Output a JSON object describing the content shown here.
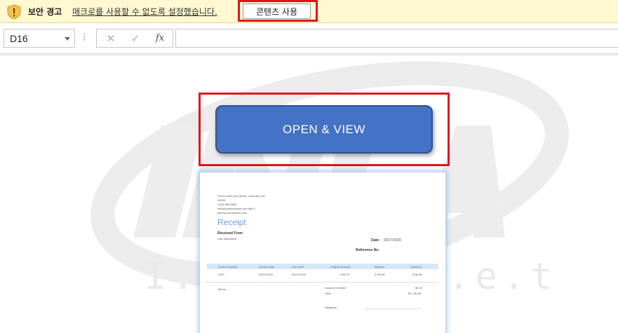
{
  "security_bar": {
    "icon": "warning-shield-icon",
    "title": "보안 경고",
    "message": "매크로를 사용할 수 없도록 설정했습니다.",
    "enable_button": "콘텐츠 사용",
    "highlight_color": "#e0141e"
  },
  "formula_bar": {
    "name_box_value": "D16",
    "cancel_glyph": "✕",
    "enter_glyph": "✓",
    "function_glyph": "fx",
    "formula_value": ""
  },
  "sheet": {
    "watermark_text": "I.n.t.e.r.n.e.t",
    "open_button_label": "OPEN & VIEW",
    "open_button_color": "#4472c4"
  },
  "receipt": {
    "address_lines": [
      "1234 Fourth Ave Street, Columbia, ND",
      "00000",
      "(700) 555-0000",
      "info@yourbusiness.com http://",
      "www.yourbusiness.com"
    ],
    "title": "Receipt",
    "received_from_label": "Received From",
    "received_from_name": "Lisa Simmonds",
    "date_label": "Date:",
    "date_value": "05/27/2020",
    "reference_label": "Reference No:",
    "columns": [
      "Invoice Number",
      "Invoice Date",
      "Due Date",
      "Original Amount",
      "Balance",
      "Payment"
    ],
    "row": [
      "2267",
      "05/27/2020",
      "05/27/2020",
      "7493.75",
      "3746.38",
      "3746.38"
    ],
    "memo_label": "Memo",
    "amount_credited_label": "Amount Credited",
    "amount_credited_value": "$0.00",
    "total_label": "Total",
    "total_value": "$3,746.38",
    "signature_label": "Signature"
  }
}
